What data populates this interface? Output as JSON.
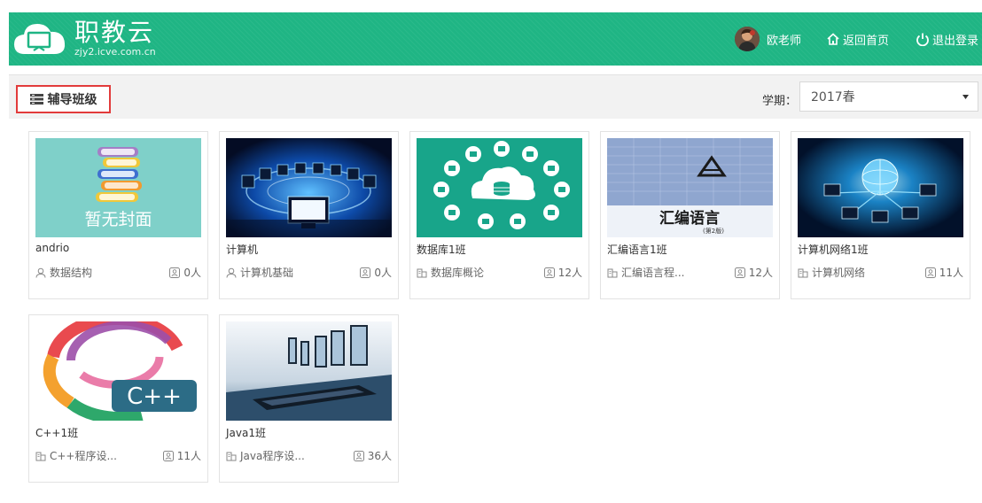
{
  "header": {
    "logo_title": "职教云",
    "logo_sub": "zjy2.icve.com.cn",
    "user_name": "欧老师",
    "home_label": "返回首页",
    "logout_label": "退出登录"
  },
  "toolbar": {
    "tab_label": "辅导班级",
    "term_label": "学期：",
    "term_value": "2017春"
  },
  "cards": [
    {
      "name": "andrio",
      "course": "数据结构",
      "count": "0人",
      "cover_text": "暂无封面"
    },
    {
      "name": "计算机",
      "course": "计算机基础",
      "count": "0人"
    },
    {
      "name": "数据库1班",
      "course": "数据库概论",
      "count": "12人"
    },
    {
      "name": "汇编语言1班",
      "course": "汇编语言程...",
      "count": "12人",
      "cover_text": "汇编语言",
      "cover_sub": "(第2版)"
    },
    {
      "name": "计算机网络1班",
      "course": "计算机网络",
      "count": "11人"
    },
    {
      "name": "C++1班",
      "course": "C++程序设...",
      "count": "11人",
      "cover_text": "C++"
    },
    {
      "name": "Java1班",
      "course": "Java程序设...",
      "count": "36人"
    }
  ],
  "colors": {
    "header": "#1fb584",
    "highlight_border": "#e23b3b"
  }
}
